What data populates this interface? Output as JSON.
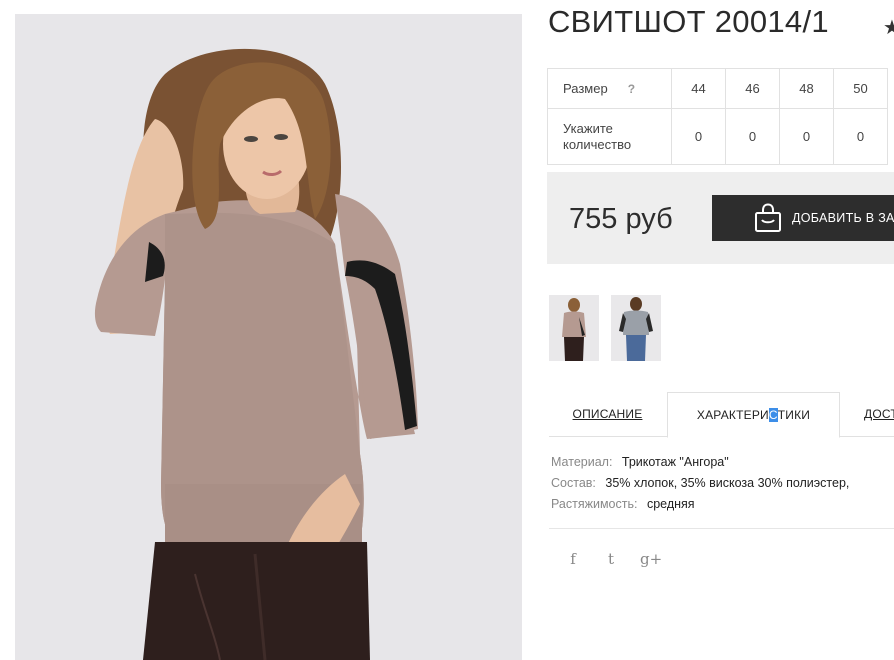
{
  "product": {
    "title": "СВИТШОТ 20014/1",
    "star_icon": "star-icon"
  },
  "sizes": {
    "size_label": "Размер",
    "help_mark": "?",
    "qty_label_line1": "Укажите",
    "qty_label_line2": "количество",
    "values": [
      "44",
      "46",
      "48",
      "50"
    ],
    "quantities": [
      "0",
      "0",
      "0",
      "0"
    ]
  },
  "price": {
    "amount": "755 руб",
    "cart_label": "ДОБАВИТЬ В ЗАКАЗ",
    "cart_icon": "shopping-bag-icon"
  },
  "tabs": {
    "description": "ОПИСАНИЕ",
    "characteristics_a": "ХАРАКТЕРИ",
    "characteristics_sel": "С",
    "characteristics_b": "ТИКИ",
    "delivery": "ДОСТАВКА"
  },
  "specs": [
    {
      "key": "Материал:",
      "value": "Трикотаж \"Ангора\""
    },
    {
      "key": "Состав:",
      "value": "35% хлопок, 35% вискоза 30% полиэстер,"
    },
    {
      "key": "Растяжимость:",
      "value": "средняя"
    }
  ],
  "social": {
    "facebook": "f",
    "twitter": "t",
    "google_plus": "g+"
  },
  "colors": {
    "button_bg": "#2d2d2d",
    "price_box_bg": "#eeeeee",
    "photo_bg": "#e7e6e9",
    "selection": "#3d8ee8"
  }
}
